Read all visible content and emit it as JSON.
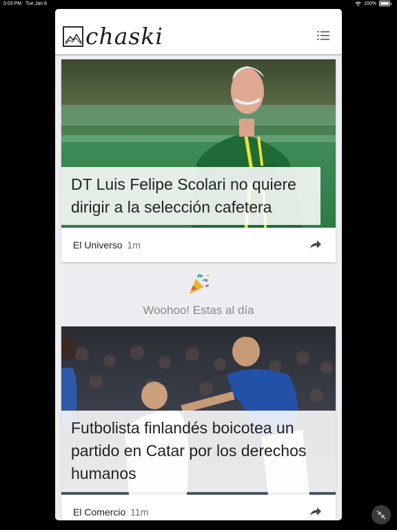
{
  "status_bar": {
    "time": "5:03 PM",
    "date": "Tue Jan 8",
    "battery": "100%"
  },
  "header": {
    "logo_text": "chaski"
  },
  "articles": [
    {
      "title": "DT Luis Felipe Scolari no quiere dirigir a la selección cafetera",
      "source": "El Universo",
      "age": "1m"
    },
    {
      "title": "Futbolista finlandés boicotea un partido en Catar por los derechos humanos",
      "source": "El Comercio",
      "age": "11m"
    }
  ],
  "caught_up": {
    "text": "Woohoo! Estas al día",
    "icon": "party-popper-icon"
  },
  "colors": {
    "accent": "#1e1e1e",
    "muted_text": "#888888",
    "card_bg": "#ffffff",
    "feed_bg": "#eeeef2"
  }
}
